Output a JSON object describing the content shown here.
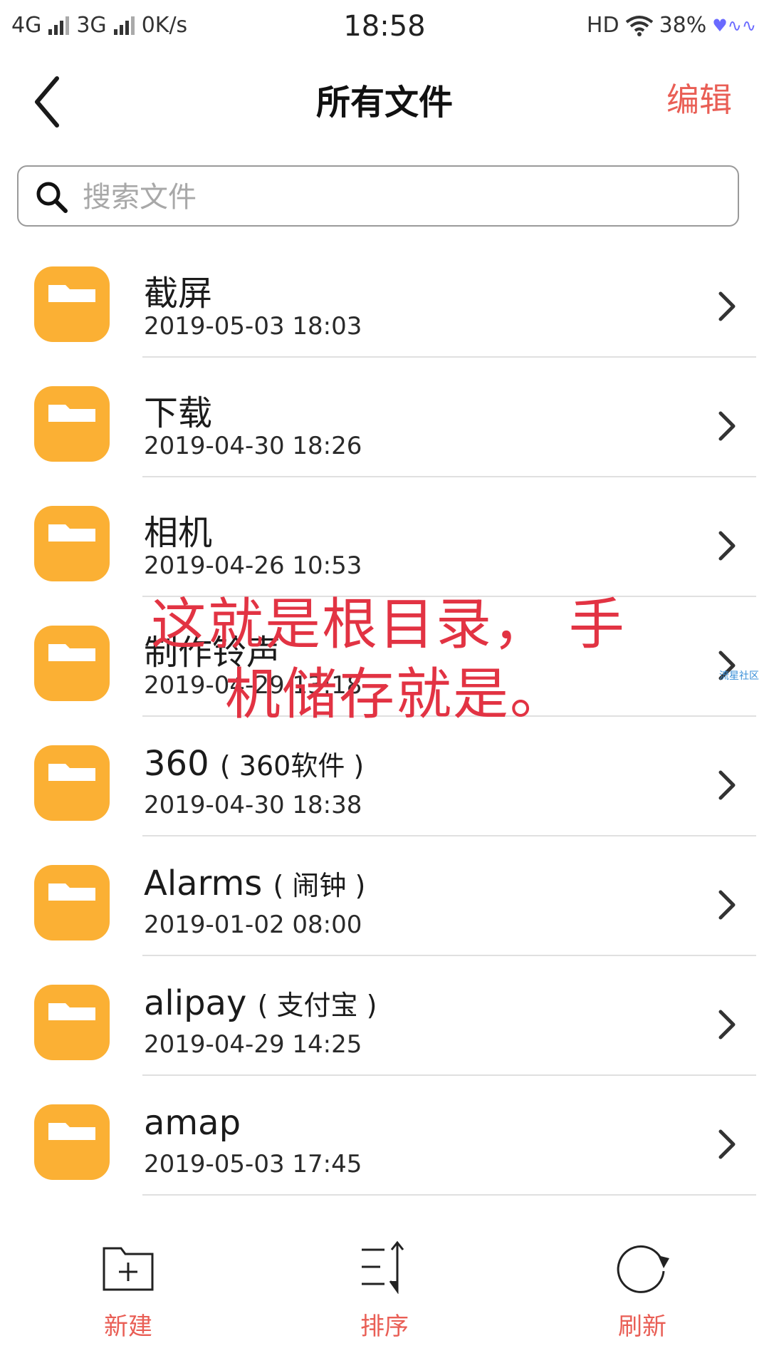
{
  "status_bar": {
    "network1": "4G",
    "network2": "3G",
    "speed": "0K/s",
    "time": "18:58",
    "hd": "HD",
    "battery": "38%"
  },
  "nav": {
    "title": "所有文件",
    "edit_label": "编辑"
  },
  "search": {
    "placeholder": "搜索文件"
  },
  "folder_color": "#fbb034",
  "accent_color": "#e95e55",
  "files": [
    {
      "name": "截屏",
      "sub": "",
      "date": "2019-05-03 18:03"
    },
    {
      "name": "下载",
      "sub": "",
      "date": "2019-04-30 18:26"
    },
    {
      "name": "相机",
      "sub": "",
      "date": "2019-04-26 10:53"
    },
    {
      "name": "制作铃声",
      "sub": "",
      "date": "2019-04-29 13:18"
    },
    {
      "name": "360",
      "sub": "( 360软件 )",
      "date": "2019-04-30 18:38"
    },
    {
      "name": "Alarms",
      "sub": "( 闹钟 )",
      "date": "2019-01-02 08:00"
    },
    {
      "name": "alipay",
      "sub": "( 支付宝 )",
      "date": "2019-04-29 14:25"
    },
    {
      "name": "amap",
      "sub": "",
      "date": "2019-05-03 17:45"
    }
  ],
  "annotation": {
    "line1": "这就是根目录， 手",
    "line2": "机储存就是。"
  },
  "watermark": "流星社区",
  "toolbar": {
    "new_label": "新建",
    "sort_label": "排序",
    "refresh_label": "刷新"
  }
}
